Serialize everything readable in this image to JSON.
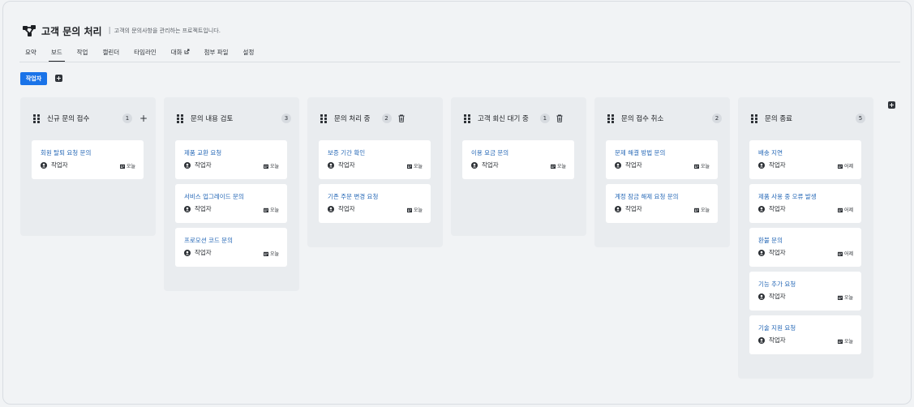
{
  "project": {
    "title": "고객 문의 처리",
    "separator": "|",
    "description": "고객의 문의사항을 관리하는 프로젝트입니다."
  },
  "tabs": [
    {
      "label": "요약"
    },
    {
      "label": "보드",
      "active": true
    },
    {
      "label": "작업"
    },
    {
      "label": "캘린더"
    },
    {
      "label": "타임라인"
    },
    {
      "label": "대화",
      "external": true
    },
    {
      "label": "첨부 파일"
    },
    {
      "label": "설정"
    }
  ],
  "toolbar": {
    "filter_label": "작업자",
    "add_icon": "plus-square-icon"
  },
  "columns": [
    {
      "title": "신규 문의 접수",
      "count": "1",
      "action": "plus",
      "cards": [
        {
          "title": "회원 탈퇴 요청 문의",
          "user": "작업자",
          "date": "오늘"
        }
      ]
    },
    {
      "title": "문의 내용 검토",
      "count": "3",
      "action": "none",
      "cards": [
        {
          "title": "제품 교환 요청",
          "user": "작업자",
          "date": "오늘"
        },
        {
          "title": "서비스 업그레이드 문의",
          "user": "작업자",
          "date": "오늘"
        },
        {
          "title": "프로모션 코드 문의",
          "user": "작업자",
          "date": "오늘"
        }
      ]
    },
    {
      "title": "문의 처리 중",
      "count": "2",
      "action": "trash",
      "cards": [
        {
          "title": "보증 기간 확인",
          "user": "작업자",
          "date": "오늘"
        },
        {
          "title": "기존 주문 변경 요청",
          "user": "작업자",
          "date": "오늘"
        }
      ]
    },
    {
      "title": "고객 회신 대기 중",
      "count": "1",
      "action": "trash",
      "cards": [
        {
          "title": "이용 요금 문의",
          "user": "작업자",
          "date": "오늘"
        }
      ]
    },
    {
      "title": "문의 접수 취소",
      "count": "2",
      "action": "none",
      "cards": [
        {
          "title": "문제 해결 방법 문의",
          "user": "작업자",
          "date": "오늘"
        },
        {
          "title": "계정 잠금 해제 요청 문의",
          "user": "작업자",
          "date": "오늘"
        }
      ]
    },
    {
      "title": "문의 종료",
      "count": "5",
      "action": "none",
      "cards": [
        {
          "title": "배송 지연",
          "user": "작업자",
          "date": "어제"
        },
        {
          "title": "제품 사용 중 오류 발생",
          "user": "작업자",
          "date": "어제"
        },
        {
          "title": "환불 문의",
          "user": "작업자",
          "date": "어제"
        },
        {
          "title": "기능 추가 요청",
          "user": "작업자",
          "date": "오늘"
        },
        {
          "title": "기술 지원 요청",
          "user": "작업자",
          "date": "오늘"
        }
      ]
    }
  ],
  "colors": {
    "accent": "#1a73e8",
    "card_title": "#2467b6",
    "column_bg": "#e9ecef"
  }
}
